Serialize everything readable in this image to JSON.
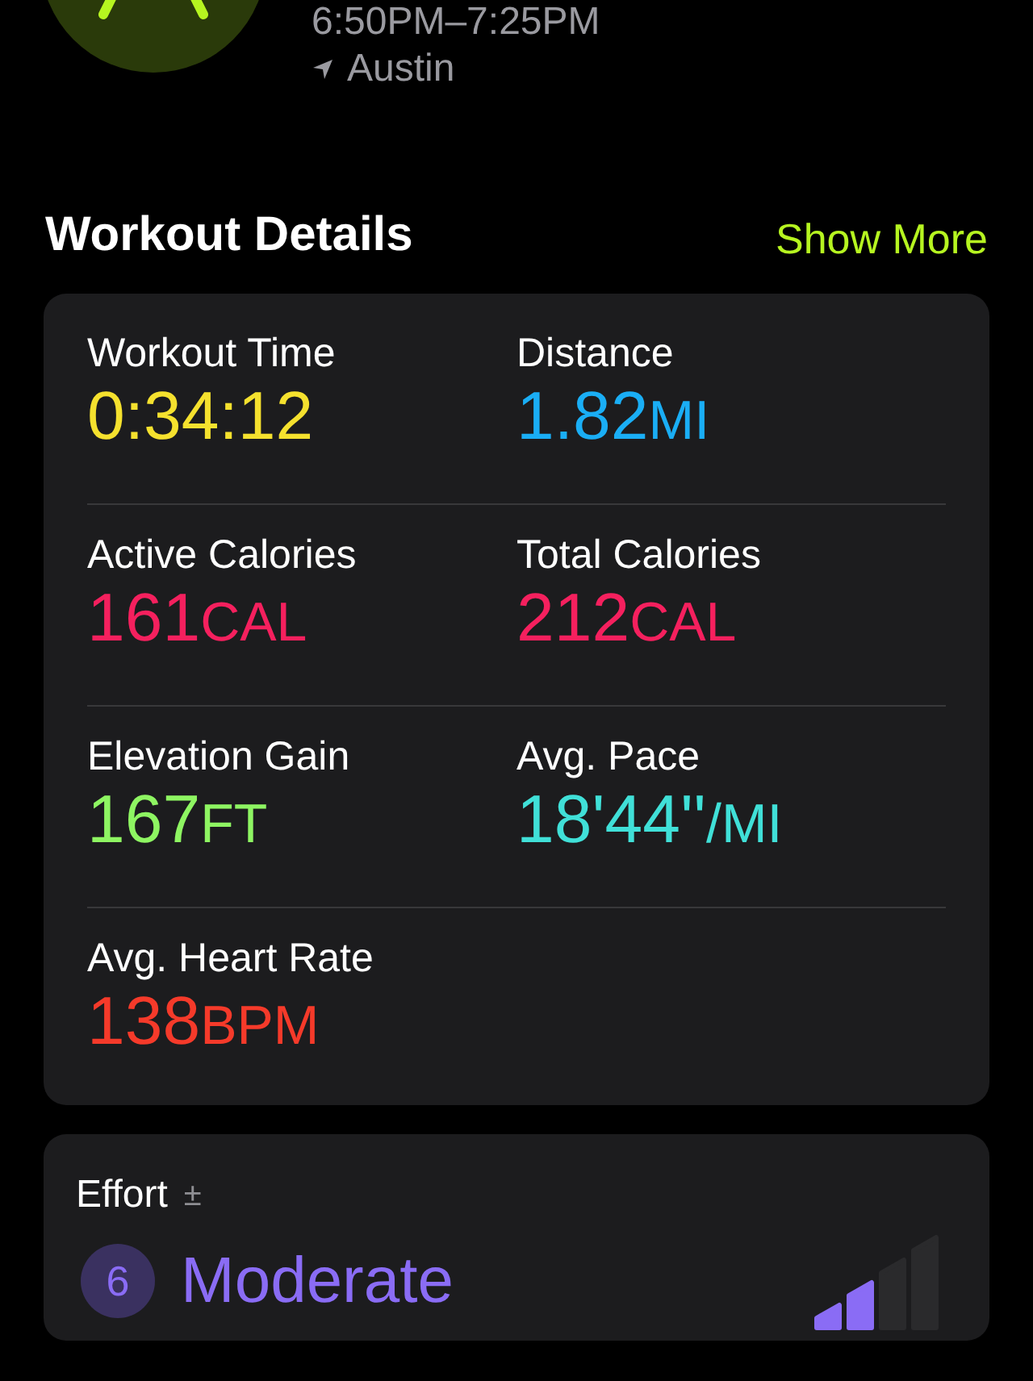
{
  "workout": {
    "time_range": "6:50PM–7:25PM",
    "location": "Austin"
  },
  "details": {
    "title": "Workout Details",
    "show_more": "Show More",
    "metrics": [
      {
        "label": "Workout Time",
        "value": "0:34:12",
        "color": "#f5e12e"
      },
      {
        "label": "Distance",
        "value": "1.82",
        "unit": "MI",
        "color": "#1aaef5"
      },
      {
        "label": "Active Calories",
        "value": "161",
        "unit": "CAL",
        "color": "#f5205e"
      },
      {
        "label": "Total Calories",
        "value": "212",
        "unit": "CAL",
        "color": "#f5205e"
      },
      {
        "label": "Elevation Gain",
        "value": "167",
        "unit": "FT",
        "color": "#8ef562"
      },
      {
        "label": "Avg. Pace",
        "value": "18'44''",
        "unit": "/MI",
        "color": "#40e0d8"
      },
      {
        "label": "Avg. Heart Rate",
        "value": "138",
        "unit": "BPM",
        "color": "#f53a2a"
      }
    ]
  },
  "effort": {
    "label": "Effort",
    "adjust": "±",
    "score": "6",
    "rating": "Moderate",
    "level": 0.5
  }
}
